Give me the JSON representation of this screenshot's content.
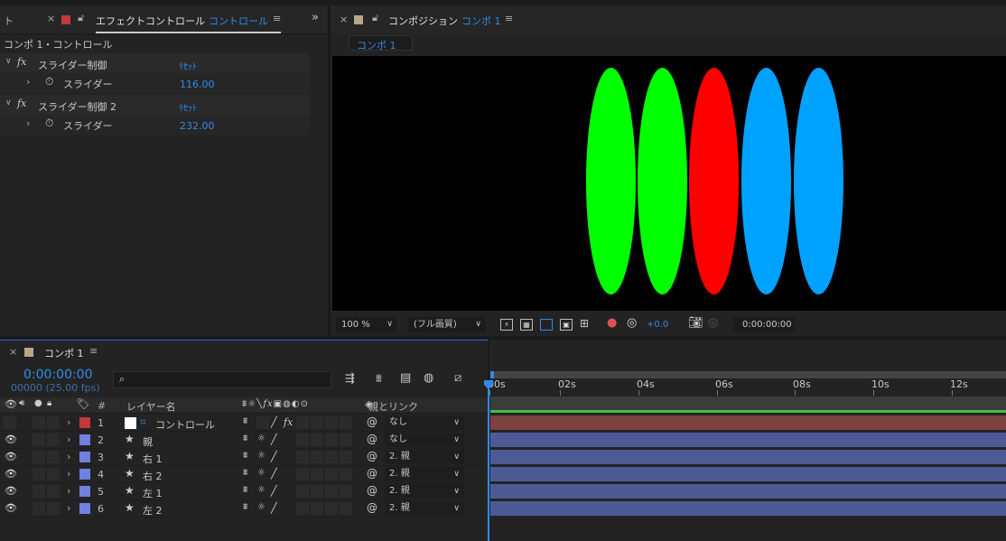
{
  "effect_panel": {
    "left_tab_fragment": "ト",
    "title": "エフェクトコントロール",
    "comp_name": "コントロール",
    "subheader": "コンポ 1・コントロール",
    "effects": [
      {
        "name": "スライダー制御",
        "reset": "ﾘｾｯﾄ",
        "param": "スライダー",
        "value": "116.00"
      },
      {
        "name": "スライダー制御 2",
        "reset": "ﾘｾｯﾄ",
        "param": "スライダー",
        "value": "232.00"
      }
    ]
  },
  "comp_panel": {
    "title": "コンポジション",
    "comp_name": "コンポ 1",
    "breadcrumb": "コンポ 1",
    "ellipses": [
      {
        "color": "#00ff00"
      },
      {
        "color": "#00ff00"
      },
      {
        "color": "#ff0000"
      },
      {
        "color": "#00a2ff"
      },
      {
        "color": "#00a2ff"
      }
    ],
    "zoom": "100 %",
    "resolution": "(フル画質)",
    "exposure": "+0.0",
    "timecode": "0:00:00:00"
  },
  "timeline": {
    "tab_name": "コンポ 1",
    "timecode": "0:00:00:00",
    "frames": "00000 (25.00 fps)",
    "search_placeholder": "",
    "col_number": "#",
    "col_layer_name": "レイヤー名",
    "col_parent": "親とリンク",
    "ruler": [
      "00s",
      "02s",
      "04s",
      "06s",
      "08s",
      "10s",
      "12s"
    ],
    "layers": [
      {
        "num": "1",
        "name": "コントロール",
        "parent": "なし",
        "label_color": "#c0393b",
        "type": "null",
        "bar_color": "#7d4140",
        "eye": false
      },
      {
        "num": "2",
        "name": "親",
        "parent": "なし",
        "label_color": "#6f80de",
        "type": "shape",
        "bar_color": "#4e5a96",
        "eye": true
      },
      {
        "num": "3",
        "name": "右 1",
        "parent": "2. 親",
        "label_color": "#6f80de",
        "type": "shape",
        "bar_color": "#4e5a96",
        "eye": true
      },
      {
        "num": "4",
        "name": "右 2",
        "parent": "2. 親",
        "label_color": "#6f80de",
        "type": "shape",
        "bar_color": "#4e5a96",
        "eye": true
      },
      {
        "num": "5",
        "name": "左 1",
        "parent": "2. 親",
        "label_color": "#6f80de",
        "type": "shape",
        "bar_color": "#4e5a96",
        "eye": true
      },
      {
        "num": "6",
        "name": "左 2",
        "parent": "2. 親",
        "label_color": "#6f80de",
        "type": "shape",
        "bar_color": "#4e5a96",
        "eye": true
      }
    ]
  },
  "colors": {
    "accent_blue": "#2d8ceb",
    "work_area_green": "#3fbf3f"
  }
}
